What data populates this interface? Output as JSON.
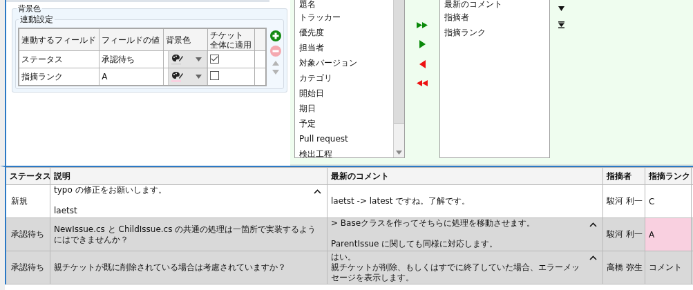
{
  "background_group": {
    "title": "背景色",
    "link_group": {
      "title": "連動設定",
      "columns": [
        [
          "連動するフィールド"
        ],
        [
          "フィールドの値"
        ],
        [
          "背景色"
        ],
        [
          "チケット",
          "全体に適用"
        ]
      ],
      "rows": [
        {
          "field": "ステータス",
          "value": "承認待ち",
          "color": "#d9d9d9",
          "checked": true
        },
        {
          "field": "指摘ランク",
          "value": "A",
          "color": "#f9d0e0",
          "checked": false
        }
      ],
      "side_buttons": [
        {
          "kind": "add",
          "disabled": false
        },
        {
          "kind": "remove",
          "disabled": true
        },
        {
          "kind": "up",
          "disabled": true
        },
        {
          "kind": "down",
          "disabled": true
        }
      ]
    }
  },
  "available_fields": [
    "題名",
    "トラッカー",
    "優先度",
    "担当者",
    "対象バージョン",
    "カテゴリ",
    "開始日",
    "期日",
    "予定",
    "Pull request",
    "検出工程"
  ],
  "move_buttons": [
    {
      "kind": "add-all"
    },
    {
      "kind": "add"
    },
    {
      "kind": "remove"
    },
    {
      "kind": "remove-all"
    }
  ],
  "selected_fields": [
    "最新のコメント",
    "指摘者",
    "指摘ランク"
  ],
  "order_buttons": [
    {
      "kind": "down"
    },
    {
      "kind": "bottom"
    }
  ],
  "table": {
    "columns": [
      "ステータス",
      "説明",
      "最新のコメント",
      "指摘者",
      "指摘ランク"
    ],
    "rows": [
      {
        "color": "#ffffff",
        "status": "新規",
        "description": {
          "paragraphs": [
            [
              "typo の修正をお願いします。"
            ],
            [
              "laetst"
            ]
          ],
          "collapsible": true
        },
        "comment": {
          "paragraphs": [
            [
              "laetst -> latest ですね。了解です。"
            ]
          ],
          "collapsible": false
        },
        "reporter": "駿河 利一",
        "rank": {
          "text": "C",
          "color": "#ffffff"
        }
      },
      {
        "color": "#d9d9d9",
        "status": "承認待ち",
        "description": {
          "paragraphs": [
            [
              "NewIssue.cs と ChildIssue.cs の共通の処理は一箇所で実装するようにはできませんか？"
            ]
          ],
          "collapsible": false
        },
        "comment": {
          "paragraphs": [
            [
              "> Baseクラスを作ってそちらに処理を移動させます。"
            ],
            [
              "ParentIssue に関しても同様に対応します。"
            ]
          ],
          "collapsible": true
        },
        "reporter": "駿河 利一",
        "rank": {
          "text": "A",
          "color": "#f9d0e0"
        }
      },
      {
        "color": "#d9d9d9",
        "status": "承認待ち",
        "description": {
          "paragraphs": [
            [
              "親チケットが既に削除されている場合は考慮されていますか？"
            ]
          ],
          "collapsible": false
        },
        "comment": {
          "paragraphs": [
            [
              "はい。",
              "親チケットが削除、もしくはすでに終了していた場合、エラーメッセージを表示します。"
            ]
          ],
          "collapsible": true
        },
        "reporter": "高橋 弥生",
        "rank": {
          "text": "コメント",
          "color": "#d9d9d9"
        }
      }
    ]
  }
}
